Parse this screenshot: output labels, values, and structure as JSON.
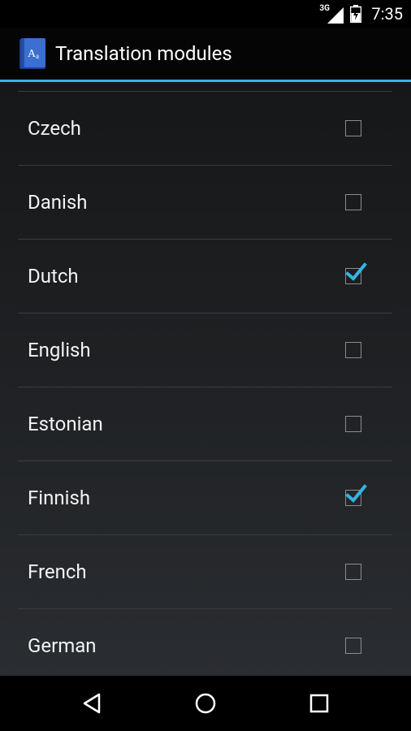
{
  "status_bar": {
    "network": "3G",
    "time": "7:35"
  },
  "action_bar": {
    "title": "Translation modules",
    "app_icon": "dictionary-icon"
  },
  "languages": [
    {
      "label": "Czech",
      "checked": false
    },
    {
      "label": "Danish",
      "checked": false
    },
    {
      "label": "Dutch",
      "checked": true
    },
    {
      "label": "English",
      "checked": false
    },
    {
      "label": "Estonian",
      "checked": false
    },
    {
      "label": "Finnish",
      "checked": true
    },
    {
      "label": "French",
      "checked": false
    },
    {
      "label": "German",
      "checked": false
    }
  ],
  "nav_bar": {
    "back": "back-icon",
    "home": "home-icon",
    "recents": "recents-icon"
  },
  "colors": {
    "accent": "#33b5e5",
    "check": "#33b5e5"
  }
}
